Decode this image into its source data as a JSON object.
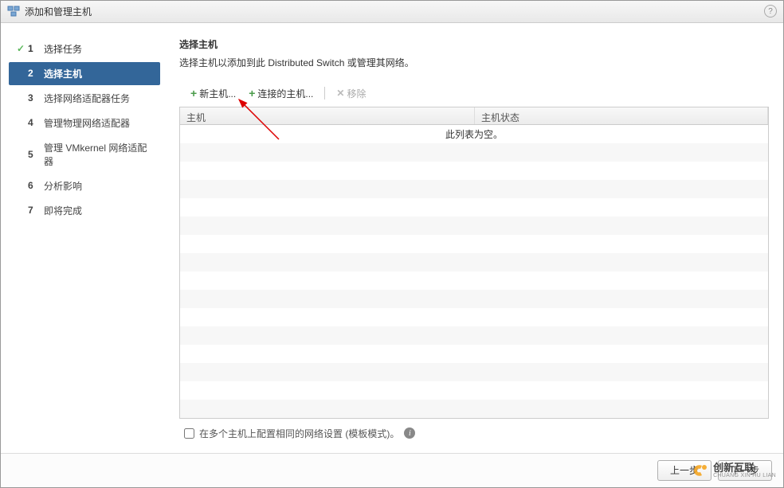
{
  "dialog": {
    "title": "添加和管理主机"
  },
  "sidebar": {
    "steps": [
      {
        "num": "1",
        "label": "选择任务",
        "state": "completed"
      },
      {
        "num": "2",
        "label": "选择主机",
        "state": "active"
      },
      {
        "num": "3",
        "label": "选择网络适配器任务",
        "state": "pending"
      },
      {
        "num": "4",
        "label": "管理物理网络适配器",
        "state": "pending"
      },
      {
        "num": "5",
        "label": "管理 VMkernel 网络适配器",
        "state": "pending"
      },
      {
        "num": "6",
        "label": "分析影响",
        "state": "pending"
      },
      {
        "num": "7",
        "label": "即将完成",
        "state": "pending"
      }
    ]
  },
  "main": {
    "title": "选择主机",
    "desc": "选择主机以添加到此 Distributed Switch 或管理其网络。"
  },
  "toolbar": {
    "new_host": "新主机...",
    "connected_host": "连接的主机...",
    "remove": "移除"
  },
  "table": {
    "col_host": "主机",
    "col_status": "主机状态",
    "empty_msg": "此列表为空。"
  },
  "checkbox": {
    "label": "在多个主机上配置相同的网络设置 (模板模式)。"
  },
  "footer": {
    "prev": "上一步",
    "next": "下一步"
  },
  "watermark": {
    "cn": "创新互联",
    "en": "CHUANG XIN HU LIAN"
  }
}
